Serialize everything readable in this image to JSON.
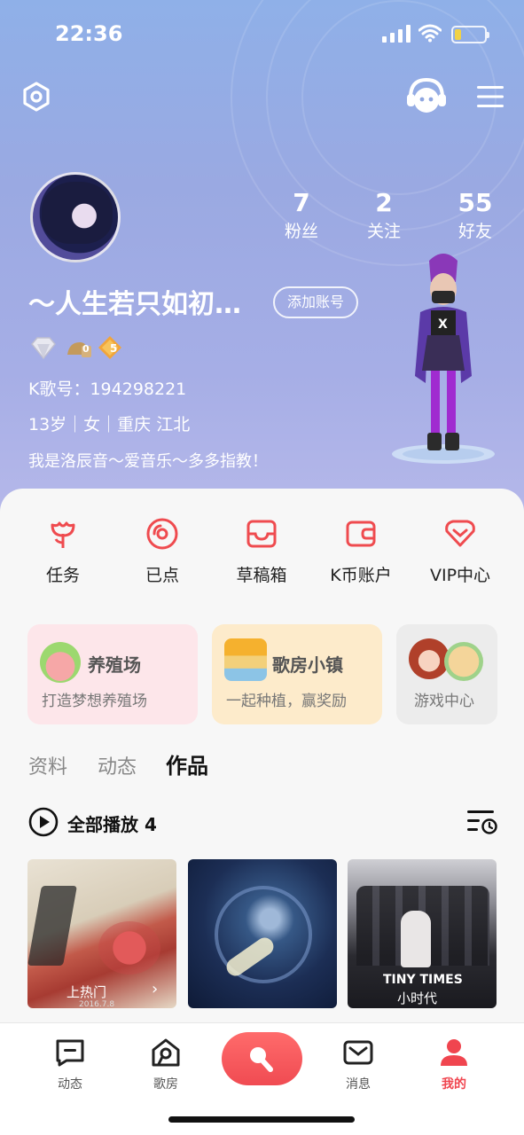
{
  "status_bar": {
    "time": "22:36"
  },
  "profile": {
    "stats": [
      {
        "value": "7",
        "label": "粉丝"
      },
      {
        "value": "2",
        "label": "关注"
      },
      {
        "value": "55",
        "label": "好友"
      }
    ],
    "nickname": "～人生若只如初…",
    "add_account_label": "添加账号",
    "badges": {
      "bronze_count": "0",
      "level_count": "5"
    },
    "k_id_label": "K歌号：194298221",
    "details": "13岁｜女｜重庆 江北",
    "bio": "我是洛辰音～爱音乐～多多指教！"
  },
  "shortcuts": [
    {
      "label": "任务",
      "icon": "flower-icon"
    },
    {
      "label": "已点",
      "icon": "disc-icon"
    },
    {
      "label": "草稿箱",
      "icon": "inbox-icon"
    },
    {
      "label": "K币账户",
      "icon": "wallet-icon"
    },
    {
      "label": "VIP中心",
      "icon": "vip-heart-icon"
    }
  ],
  "cards": [
    {
      "title": "养殖场",
      "subtitle": "打造梦想养殖场"
    },
    {
      "title": "歌房小镇",
      "subtitle": "一起种植，赢奖励"
    },
    {
      "title": "",
      "subtitle": "游戏中心"
    }
  ],
  "tabs": [
    {
      "label": "资料"
    },
    {
      "label": "动态"
    },
    {
      "label": "作品",
      "active": true
    }
  ],
  "works": {
    "play_all_label": "全部播放 4",
    "thumbs": [
      {
        "caption": "上热门",
        "date": "2016.7.8"
      },
      {
        "caption": ""
      },
      {
        "caption_en": "TINY TIMES",
        "caption_cn": "小时代"
      }
    ]
  },
  "bottom_nav": [
    {
      "label": "动态",
      "icon": "feed-icon"
    },
    {
      "label": "歌房",
      "icon": "room-icon"
    },
    {
      "label": "消息",
      "icon": "message-icon"
    },
    {
      "label": "我的",
      "icon": "profile-icon",
      "active": true
    }
  ],
  "colors": {
    "accent": "#f0454f",
    "hero_top": "#8fb0e8",
    "hero_bottom": "#b7b9ea"
  }
}
